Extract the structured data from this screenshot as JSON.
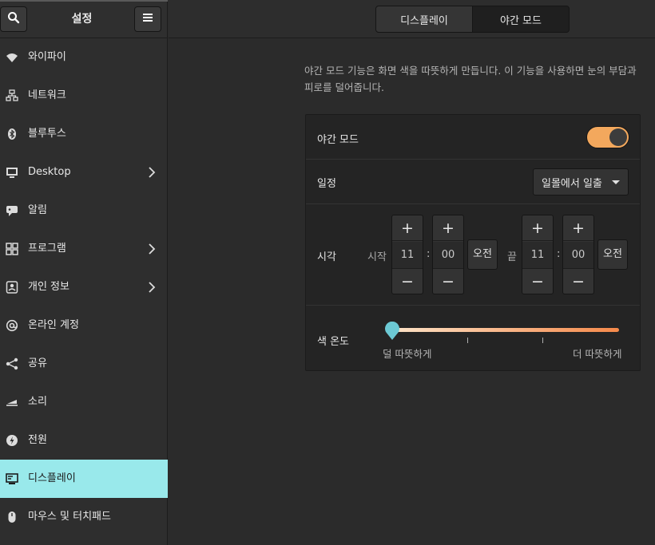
{
  "sidebar": {
    "title": "설정",
    "items": [
      {
        "label": "와이파이",
        "icon": "wifi-icon",
        "chevron": false
      },
      {
        "label": "네트워크",
        "icon": "network-icon",
        "chevron": false
      },
      {
        "label": "블루투스",
        "icon": "bluetooth-icon",
        "chevron": false
      },
      {
        "label": "Desktop",
        "icon": "desktop-icon",
        "chevron": true
      },
      {
        "label": "알림",
        "icon": "notifications-icon",
        "chevron": false
      },
      {
        "label": "프로그램",
        "icon": "apps-icon",
        "chevron": true
      },
      {
        "label": "개인 정보",
        "icon": "privacy-icon",
        "chevron": true
      },
      {
        "label": "온라인 계정",
        "icon": "at-icon",
        "chevron": false
      },
      {
        "label": "공유",
        "icon": "share-icon",
        "chevron": false
      },
      {
        "label": "소리",
        "icon": "sound-icon",
        "chevron": false
      },
      {
        "label": "전원",
        "icon": "power-icon",
        "chevron": false
      },
      {
        "label": "디스플레이",
        "icon": "display-icon",
        "chevron": false,
        "active": true
      },
      {
        "label": "마우스 및 터치패드",
        "icon": "mouse-icon",
        "chevron": false
      }
    ]
  },
  "header": {
    "tabs": [
      {
        "label": "디스플레이",
        "active": false
      },
      {
        "label": "야간 모드",
        "active": true
      }
    ]
  },
  "night_light": {
    "description": "야간 모드 기능은 화면 색을 따뜻하게 만듭니다. 이 기능을 사용하면 눈의 부담과 피로를 덜어줍니다.",
    "toggle_label": "야간 모드",
    "toggle_on": true,
    "schedule_label": "일정",
    "schedule_value": "일몰에서 일출",
    "time_label": "시각",
    "start_label": "시작",
    "end_label": "끝",
    "start_hour": "11",
    "start_minute": "00",
    "start_ampm": "오전",
    "end_hour": "11",
    "end_minute": "00",
    "end_ampm": "오전",
    "plus": "+",
    "minus": "−",
    "colon": ":",
    "temperature_label": "색 온도",
    "temperature_min_label": "덜 따뜻하게",
    "temperature_max_label": "더 따뜻하게",
    "temperature_level": 0
  },
  "colors": {
    "accent_active": "#99e9eb",
    "toggle_on": "#f3a85d",
    "slider_start": "#fde3c7",
    "slider_end": "#f5894a",
    "slider_knob": "#6cc9d4"
  }
}
